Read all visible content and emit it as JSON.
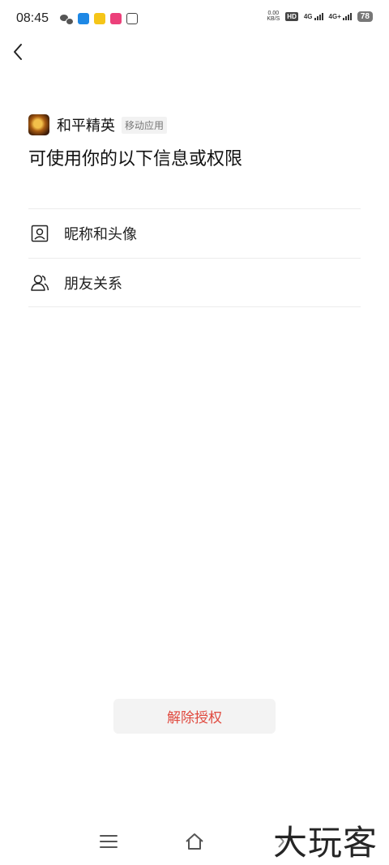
{
  "status_bar": {
    "time": "08:45",
    "net_speed_value": "0.00",
    "net_speed_unit": "KB/S",
    "hd": "HD",
    "sim1_label": "4G",
    "sim2_label": "4G+",
    "battery": "78"
  },
  "app": {
    "name": "和平精英",
    "tag": "移动应用"
  },
  "page_title": "可使用你的以下信息或权限",
  "permissions": [
    {
      "label": "昵称和头像",
      "icon": "profile-card-icon"
    },
    {
      "label": "朋友关系",
      "icon": "friends-icon"
    }
  ],
  "revoke_button": "解除授权",
  "watermark": "大玩客",
  "colors": {
    "revoke_text": "#e04a3f",
    "revoke_bg": "#f3f3f3",
    "divider": "#ececec"
  }
}
